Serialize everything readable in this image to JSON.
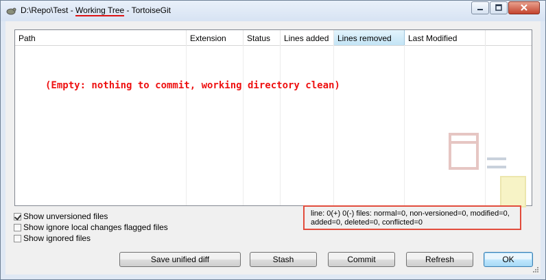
{
  "window": {
    "title_prefix": "D:\\Repo\\Test - ",
    "title_highlight": "Working Tree",
    "title_suffix": " - TortoiseGit",
    "highlight_color": "#dd1111"
  },
  "list": {
    "columns": [
      "Path",
      "Extension",
      "Status",
      "Lines added",
      "Lines removed",
      "Last Modified"
    ],
    "active_column": "Lines removed",
    "empty_message": "(Empty: nothing to commit, working directory clean)"
  },
  "options": [
    {
      "label": "Show unversioned files",
      "checked": true
    },
    {
      "label": "Show ignore local changes flagged files",
      "checked": false
    },
    {
      "label": "Show ignored files",
      "checked": false
    }
  ],
  "stats": {
    "line1": "line: 0(+) 0(-) files: normal=0, non-versioned=0, modified=0,",
    "line2": "added=0, deleted=0, conflicted=0"
  },
  "buttons": {
    "save_diff": "Save unified diff",
    "stash": "Stash",
    "commit": "Commit",
    "refresh": "Refresh",
    "ok": "OK"
  }
}
